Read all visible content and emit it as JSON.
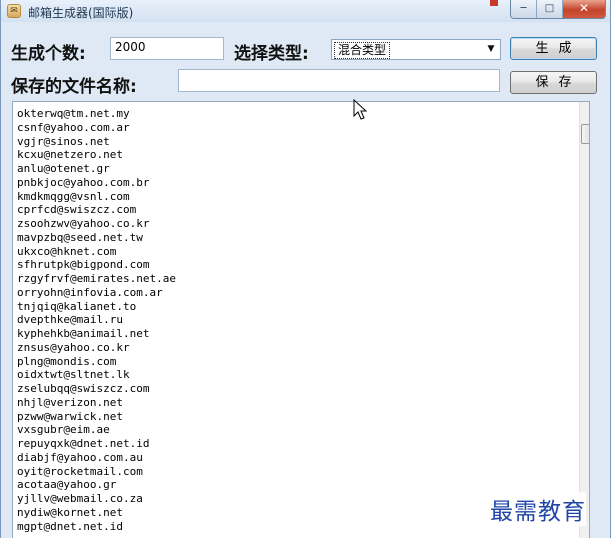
{
  "window": {
    "title": "邮箱生成器(国际版)"
  },
  "controls": {
    "count_label": "生成个数:",
    "count_value": "2000",
    "type_label": "选择类型:",
    "type_selected": "混合类型",
    "generate_label": "生成",
    "filename_label": "保存的文件名称:",
    "filename_value": "",
    "save_label": "保存"
  },
  "emails": [
    "okterwq@tm.net.my",
    "csnf@yahoo.com.ar",
    "vgjr@sinos.net",
    "kcxu@netzero.net",
    "anlu@otenet.gr",
    "pnbkjoc@yahoo.com.br",
    "kmdkmqgg@vsnl.com",
    "cprfcd@swiszcz.com",
    "zsoohzwv@yahoo.co.kr",
    "mavpzbq@seed.net.tw",
    "ukxco@hknet.com",
    "sfhrutpk@bigpond.com",
    "rzgyfrvf@emirates.net.ae",
    "orryohn@infovia.com.ar",
    "tnjqiq@kalianet.to",
    "dvepthke@mail.ru",
    "kyphehkb@animail.net",
    "znsus@yahoo.co.kr",
    "plng@mondis.com",
    "oidxtwt@sltnet.lk",
    "zselubqq@swiszcz.com",
    "nhjl@verizon.net",
    "pzww@warwick.net",
    "vxsgubr@eim.ae",
    "repuyqxk@dnet.net.id",
    "diabjf@yahoo.com.au",
    "oyit@rocketmail.com",
    "acotaa@yahoo.gr",
    "yjllv@webmail.co.za",
    "nydiw@kornet.net",
    "mgpt@dnet.net.id"
  ],
  "watermark": "最需教育"
}
